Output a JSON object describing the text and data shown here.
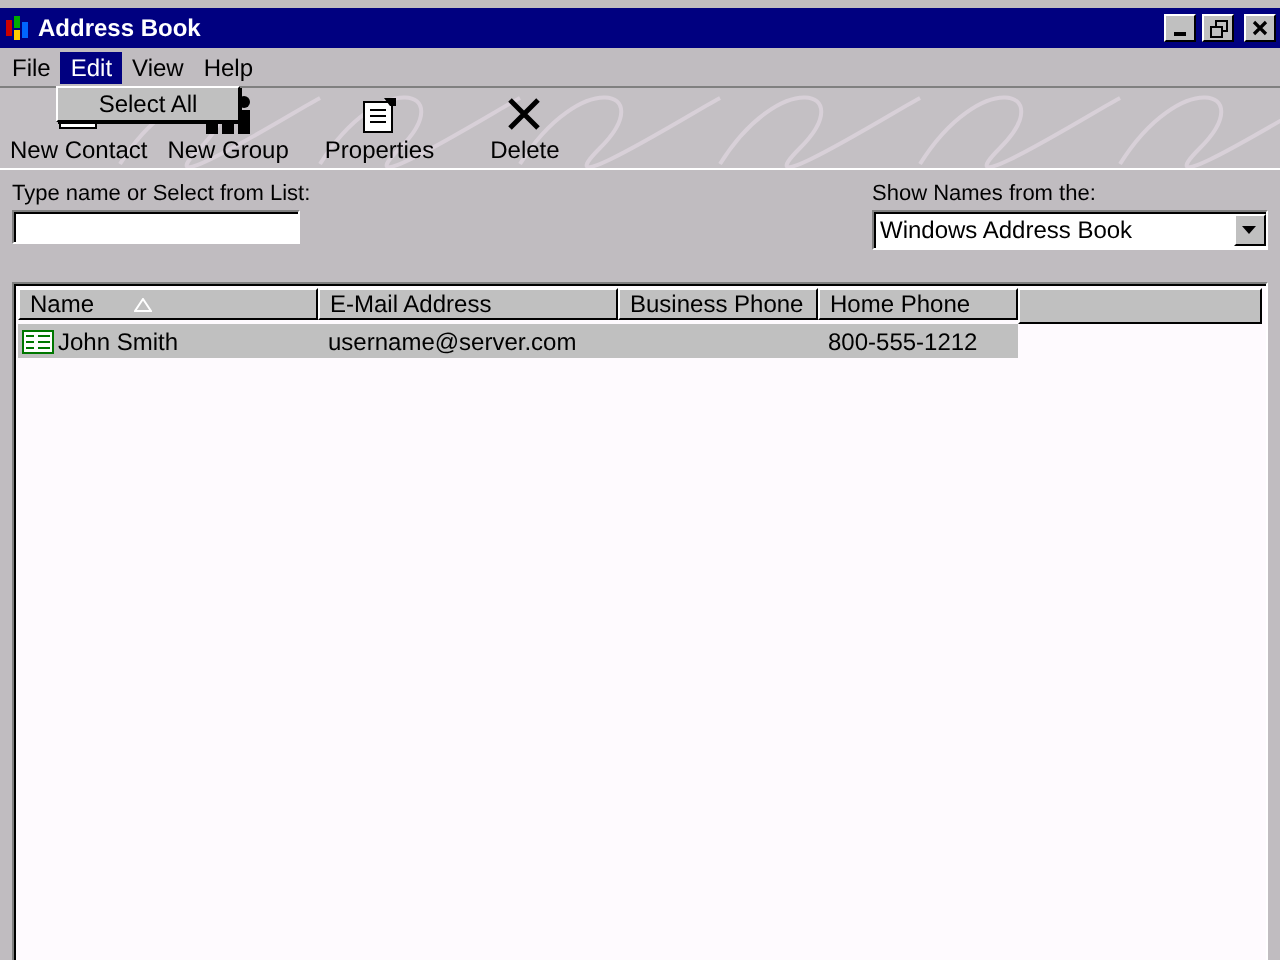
{
  "window": {
    "title": "Address Book"
  },
  "menu_bar": [
    {
      "label": "File",
      "selected": false
    },
    {
      "label": "Edit",
      "selected": true
    },
    {
      "label": "View",
      "selected": false
    },
    {
      "label": "Help",
      "selected": false
    }
  ],
  "open_menu": {
    "items": [
      "Select All"
    ]
  },
  "toolbar": [
    {
      "label": "New Contact",
      "kind": "contact"
    },
    {
      "label": "New Group",
      "kind": "group"
    },
    {
      "label": "Properties",
      "kind": "properties"
    },
    {
      "label": "Delete",
      "kind": "delete"
    }
  ],
  "search": {
    "label": "Type name or Select from List:"
  },
  "source": {
    "label": "Show Names from the:",
    "value": "Windows Address Book"
  },
  "table": {
    "columns": [
      {
        "label": "Name",
        "sorted": true
      },
      {
        "label": "E-Mail Address",
        "sorted": false
      },
      {
        "label": "Business Phone",
        "sorted": false
      },
      {
        "label": "Home Phone",
        "sorted": false
      }
    ],
    "rows": [
      {
        "cells": [
          "John Smith",
          "username@server.com",
          "",
          "800-555-1212"
        ],
        "selected": true
      }
    ]
  }
}
